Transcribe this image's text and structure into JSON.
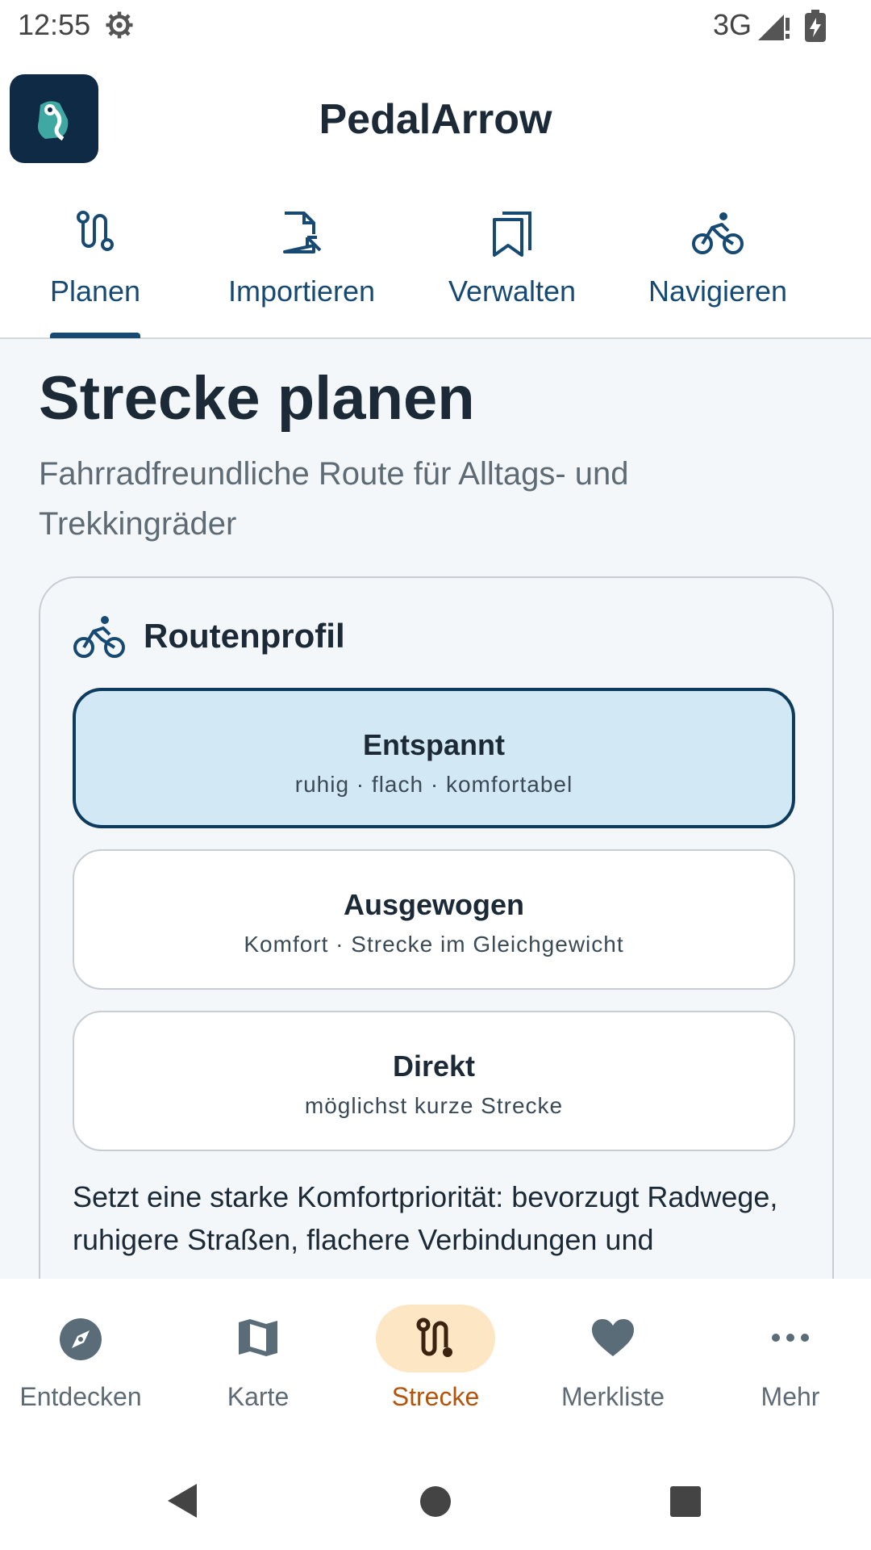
{
  "status": {
    "time": "12:55",
    "network": "3G"
  },
  "app": {
    "title": "PedalArrow"
  },
  "top_tabs": [
    {
      "label": "Planen",
      "icon": "route-icon",
      "active": true
    },
    {
      "label": "Importieren",
      "icon": "file-import-icon",
      "active": false
    },
    {
      "label": "Verwalten",
      "icon": "bookmarks-icon",
      "active": false
    },
    {
      "label": "Navigieren",
      "icon": "bike-icon",
      "active": false
    }
  ],
  "page": {
    "title": "Strecke planen",
    "subtitle": "Fahrradfreundliche Route für Alltags- und Trekkingräder"
  },
  "profile": {
    "heading": "Routenprofil",
    "options": [
      {
        "title": "Entspannt",
        "subtitle": "ruhig · flach · komfortabel",
        "selected": true
      },
      {
        "title": "Ausgewogen",
        "subtitle": "Komfort · Strecke im Gleichgewicht",
        "selected": false
      },
      {
        "title": "Direkt",
        "subtitle": "möglichst kurze Strecke",
        "selected": false
      }
    ],
    "description": "Setzt eine starke Komfortpriorität: bevorzugt Radwege, ruhigere Straßen, flachere Verbindungen und"
  },
  "bottom_nav": [
    {
      "label": "Entdecken",
      "icon": "compass-icon",
      "active": false
    },
    {
      "label": "Karte",
      "icon": "map-icon",
      "active": false
    },
    {
      "label": "Strecke",
      "icon": "route-icon",
      "active": true
    },
    {
      "label": "Merkliste",
      "icon": "heart-icon",
      "active": false
    },
    {
      "label": "Mehr",
      "icon": "more-icon",
      "active": false
    }
  ],
  "colors": {
    "primary": "#174a73",
    "selected_bg": "#d3e8f5",
    "selected_border": "#0c3b5e",
    "accent": "#b4540c",
    "accent_bg": "#fde6c4"
  }
}
